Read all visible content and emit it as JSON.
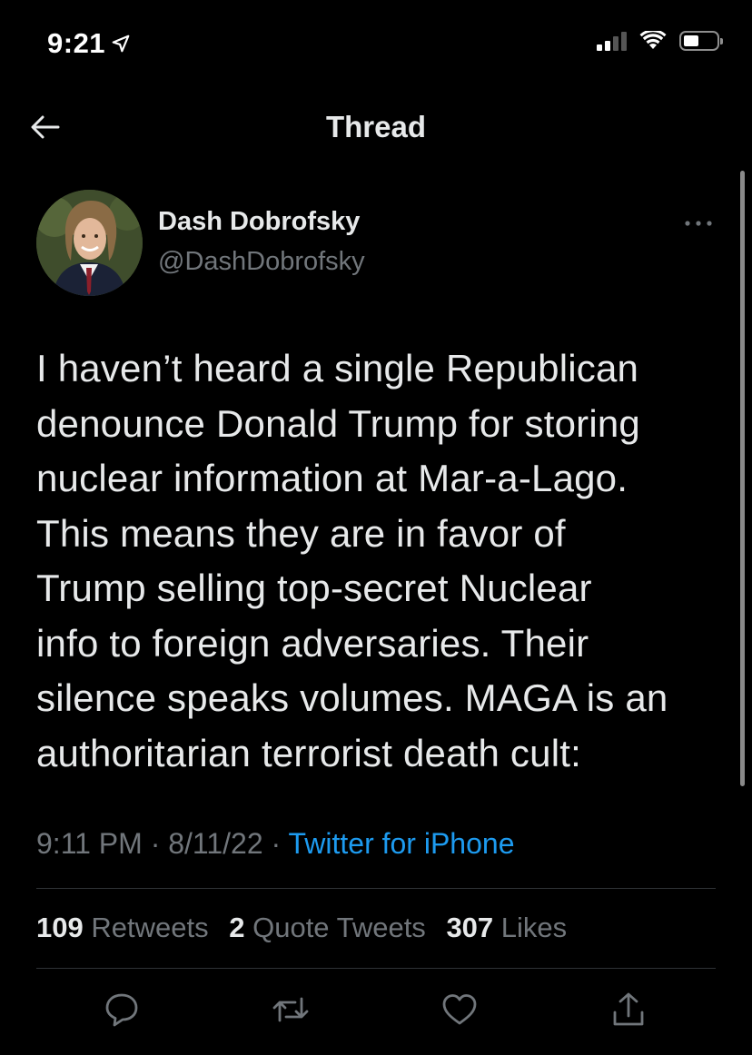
{
  "status_bar": {
    "time": "9:21"
  },
  "header": {
    "title": "Thread"
  },
  "tweet": {
    "author_name": "Dash Dobrofsky",
    "author_handle": "@DashDobrofsky",
    "text_lines": [
      "I haven’t heard a single Republican",
      "denounce Donald Trump for storing",
      "nuclear information at Mar-a-Lago.",
      "This means they are in favor of",
      "Trump selling top-secret Nuclear",
      "info to foreign adversaries. Their",
      "silence speaks volumes. MAGA is an",
      "authoritarian terrorist death cult:"
    ],
    "time": "9:11 PM",
    "date": "8/11/22",
    "separator": "·",
    "source": "Twitter for iPhone"
  },
  "stats": {
    "retweets_count": "109",
    "retweets_label": "Retweets",
    "quotes_count": "2",
    "quotes_label": "Quote Tweets",
    "likes_count": "307",
    "likes_label": "Likes"
  },
  "colors": {
    "background": "#000000",
    "text": "#e7e9ea",
    "muted": "#71767b",
    "accent": "#1d9bf0",
    "divider": "#2f3336"
  },
  "icons": {
    "back": "arrow-left-icon",
    "more": "more-dots-icon",
    "reply": "reply-bubble-icon",
    "retweet": "retweet-icon",
    "like": "heart-icon",
    "share": "share-icon"
  }
}
